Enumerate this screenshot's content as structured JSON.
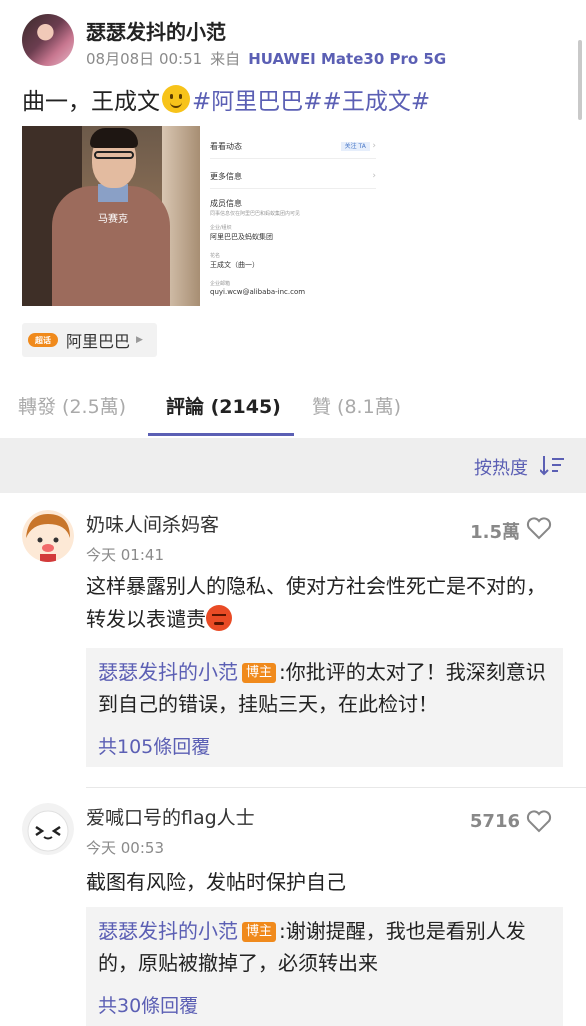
{
  "post": {
    "username": "瑟瑟发抖的小范",
    "timestamp": "08月08日 00:51",
    "source_prefix": "来自",
    "device": "HUAWEI Mate30 Pro 5G",
    "text_plain": "曲一，王成文",
    "hashtags": "#阿里巴巴##王成文#",
    "image": {
      "caption": "马赛克",
      "rows": [
        "看看动态",
        "关注 TA",
        "更多信息",
        "成员信息",
        "同事信息仅在阿里巴巴和蚂蚁集团内可见",
        "企业/组织",
        "阿里巴巴及蚂蚁集团",
        "花名",
        "王成文（曲一）",
        "企业邮箱",
        "quyi.wcw@alibaba-inc.com"
      ]
    },
    "topic": {
      "badge": "超话",
      "label": "阿里巴巴"
    }
  },
  "tabs": [
    {
      "label": "轉發 (2.5萬)",
      "active": false
    },
    {
      "label": "評論 (2145)",
      "active": true
    },
    {
      "label": "贊 (8.1萬)",
      "active": false
    }
  ],
  "sort": {
    "label": "按热度"
  },
  "comments": [
    {
      "name": "奶味人间杀妈客",
      "time": "今天 01:41",
      "likes": "1.5萬",
      "body": "这样暴露别人的隐私、使对方社会性死亡是不对的，转发以表谴责",
      "reply": {
        "author": "瑟瑟发抖的小范",
        "badge": "博主",
        "text": ":你批评的太对了！我深刻意识到自己的错误，挂贴三天，在此检讨！",
        "count": "共105條回覆"
      }
    },
    {
      "name": "爱喊口号的flag人士",
      "time": "今天 00:53",
      "likes": "5716",
      "body": "截图有风险，发帖时保护自己",
      "reply": {
        "author": "瑟瑟发抖的小范",
        "badge": "博主",
        "text": ":谢谢提醒，我也是看别人发的，原贴被撤掉了，必须转出来",
        "count": "共30條回覆"
      }
    }
  ],
  "colors": {
    "accent": "#5b5fb4",
    "badge": "#f08a1c",
    "sortbar": "#eeeeee"
  }
}
